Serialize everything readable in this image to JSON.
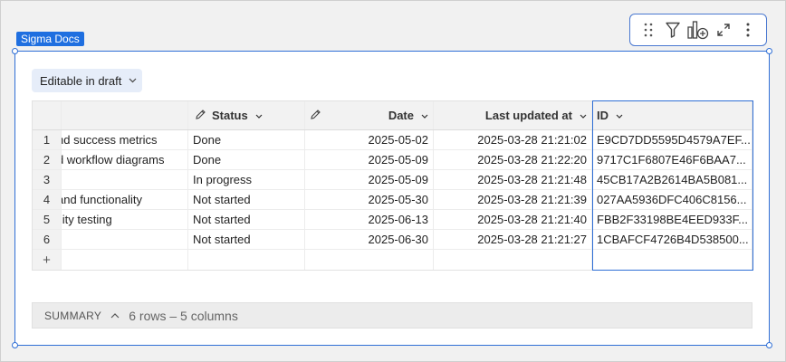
{
  "element_tag": "Sigma Docs",
  "toolbar": {
    "icons": [
      "drag-handle-icon",
      "filter-icon",
      "add-chart-icon",
      "expand-icon",
      "more-icon"
    ]
  },
  "draft_chip": {
    "label": "Editable in draft",
    "caret": "⌄"
  },
  "table": {
    "columns": [
      {
        "label": "",
        "editable": false
      },
      {
        "label": "Status",
        "editable": true
      },
      {
        "label": "",
        "editable": true
      },
      {
        "label": "Date",
        "editable": false
      },
      {
        "label": "Last updated at",
        "editable": false
      },
      {
        "label": "ID",
        "editable": false
      }
    ],
    "rows": [
      {
        "index": "1",
        "task": "nd success metrics",
        "status": "Done",
        "date": "2025-05-02",
        "updated": "2025-03-28 21:21:02",
        "id": "E9CD7DD5595D4579A7EF..."
      },
      {
        "index": "2",
        "task": "d workflow diagrams",
        "status": "Done",
        "date": "2025-05-09",
        "updated": "2025-03-28 21:22:20",
        "id": "9717C1F6807E46F6BAA7..."
      },
      {
        "index": "3",
        "task": "│",
        "status": "In progress",
        "date": "2025-05-09",
        "updated": "2025-03-28 21:21:48",
        "id": "45CB17A2B2614BA5B081..."
      },
      {
        "index": "4",
        "task": " and functionality",
        "status": "Not started",
        "date": "2025-05-30",
        "updated": "2025-03-28 21:21:39",
        "id": "027AA5936DFC406C8156..."
      },
      {
        "index": "5",
        "task": "ility testing",
        "status": "Not started",
        "date": "2025-06-13",
        "updated": "2025-03-28 21:21:40",
        "id": "FBB2F33198BE4EED933F..."
      },
      {
        "index": "6",
        "task": "",
        "status": "Not started",
        "date": "2025-06-30",
        "updated": "2025-03-28 21:21:27",
        "id": "1CBAFCF4726B4D538500..."
      }
    ],
    "add_row_symbol": "+"
  },
  "summary": {
    "label": "SUMMARY",
    "caret": "⌃",
    "text": "6 rows – 5 columns"
  },
  "colors": {
    "accent": "#2f6fd6",
    "tag_bg": "#1f6fe0",
    "chip_bg": "#e6edf9"
  }
}
